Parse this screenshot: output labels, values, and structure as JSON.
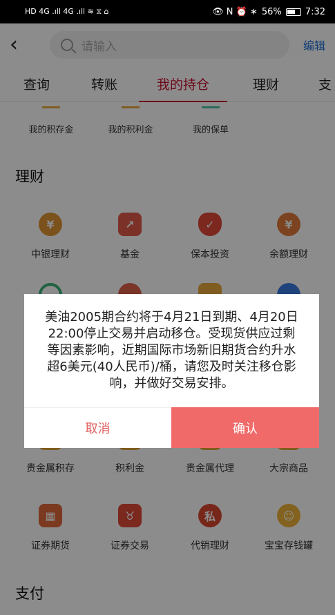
{
  "statusbar": {
    "left": "HD 4G .ıll 4G .ıll ≋ ⧖ ⌂",
    "right_icons": "👁 N ⏰ ∗",
    "battery": "56%",
    "time": "7:32"
  },
  "search": {
    "placeholder": "请输入",
    "edit_label": "编辑"
  },
  "tabs": [
    "查询",
    "转账",
    "我的持仓",
    "理财",
    "支"
  ],
  "mini": [
    {
      "label": "我的积存金",
      "color": "#e8a93c"
    },
    {
      "label": "我的积利金",
      "color": "#e8a93c"
    },
    {
      "label": "我的保单",
      "color": "#4fc1a6"
    }
  ],
  "sections": {
    "licai": "理财",
    "zhifu": "支付"
  },
  "licai_items": [
    {
      "label": "中银理财",
      "icon": "money-bag-icon",
      "color": "#e09434",
      "glyph": "¥"
    },
    {
      "label": "基金",
      "icon": "chart-up-icon",
      "color": "#e05a4a",
      "glyph": "↗"
    },
    {
      "label": "保本投资",
      "icon": "shield-icon",
      "color": "#e24a3a",
      "glyph": "✓"
    },
    {
      "label": "余额理财",
      "icon": "coin-bag-icon",
      "color": "#e07a3a",
      "glyph": "¥"
    }
  ],
  "metal_items": [
    {
      "label": "贵金属积存",
      "icon": "gold-bar-icon",
      "color": "#e8a93c"
    },
    {
      "label": "积利金",
      "icon": "gold-icon",
      "color": "#e8a93c"
    },
    {
      "label": "贵金属代理",
      "icon": "gold-agent-icon",
      "color": "#e8a93c"
    },
    {
      "label": "大宗商品",
      "icon": "commodity-icon",
      "color": "#e8a93c"
    }
  ],
  "sec_items": [
    {
      "label": "证券期货",
      "icon": "bar-chart-icon",
      "color": "#e06a3a",
      "glyph": "▦"
    },
    {
      "label": "证券交易",
      "icon": "bull-icon",
      "color": "#e04a3a",
      "glyph": "♉"
    },
    {
      "label": "代销理财",
      "icon": "private-icon",
      "color": "#d9482e",
      "glyph": "私"
    },
    {
      "label": "宝宝存钱罐",
      "icon": "piggy-bank-icon",
      "color": "#eeb23a",
      "glyph": "☺"
    }
  ],
  "dialog": {
    "message": "美油2005期合约将于4月21日到期、4月20日22:00停止交易并启动移仓。受现货供应过剩等因素影响，近期国际市场新旧期货合约升水超6美元(40人民币)/桶，请您及时关注移仓影响，并做好交易安排。",
    "cancel": "取消",
    "confirm": "确认"
  }
}
